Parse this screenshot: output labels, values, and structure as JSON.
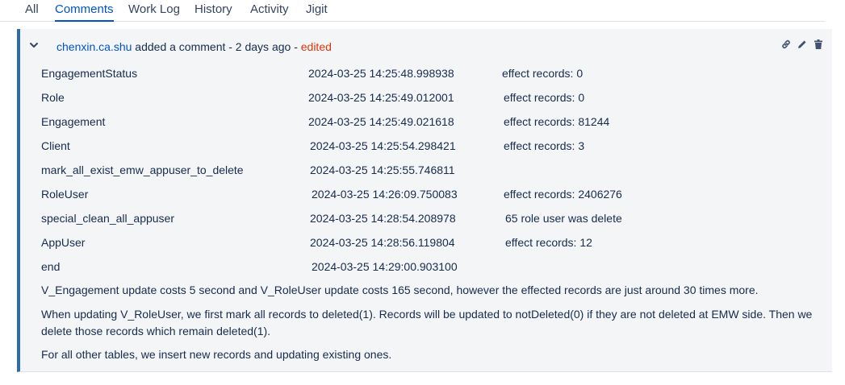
{
  "tabs": [
    {
      "label": "All",
      "active": false
    },
    {
      "label": "Comments",
      "active": true
    },
    {
      "label": "Work Log",
      "active": false
    },
    {
      "label": "History",
      "active": false
    },
    {
      "label": "Activity",
      "active": false
    },
    {
      "label": "Jigit",
      "active": false
    }
  ],
  "comment": {
    "author": "chenxin.ca.shu",
    "action": " added a comment - 2 days ago - ",
    "edited": "edited",
    "icons": [
      "link-icon",
      "edit-icon",
      "trash-icon"
    ],
    "log_rows": [
      {
        "name": "EngagementStatus",
        "timestamp": "2024-03-25 14:25:48.998938",
        "result": "effect records: 0"
      },
      {
        "name": "Role",
        "timestamp": "2024-03-25 14:25:49.012001",
        "result": "effect records: 0"
      },
      {
        "name": "Engagement",
        "timestamp": "2024-03-25 14:25:49.021618",
        "result": "effect records: 81244"
      },
      {
        "name": "Client",
        "timestamp": "2024-03-25 14:25:54.298421",
        "result": "effect records: 3"
      },
      {
        "name": "mark_all_exist_emw_appuser_to_delete",
        "timestamp": "2024-03-25 14:25:55.746811",
        "result": ""
      },
      {
        "name": "RoleUser",
        "timestamp": "2024-03-25 14:26:09.750083",
        "result": "effect records: 2406276"
      },
      {
        "name": "special_clean_all_appuser",
        "timestamp": "2024-03-25 14:28:54.208978",
        "result": "65 role user was delete"
      },
      {
        "name": "AppUser",
        "timestamp": "2024-03-25 14:28:56.119804",
        "result": "effect records: 12"
      },
      {
        "name": "end",
        "timestamp": "2024-03-25 14:29:00.903100",
        "result": ""
      }
    ],
    "paragraphs": [
      "V_Engagement update costs 5 second and V_RoleUser update costs 165 second, however the effected records are just around 30 times more.",
      "When updating V_RoleUser, we first mark all records to deleted(1). Records will be updated to notDeleted(0) if they are not deleted at EMW side. Then we delete those records which remain deleted(1).",
      "For all other tables, we insert new records and updating existing ones."
    ]
  }
}
